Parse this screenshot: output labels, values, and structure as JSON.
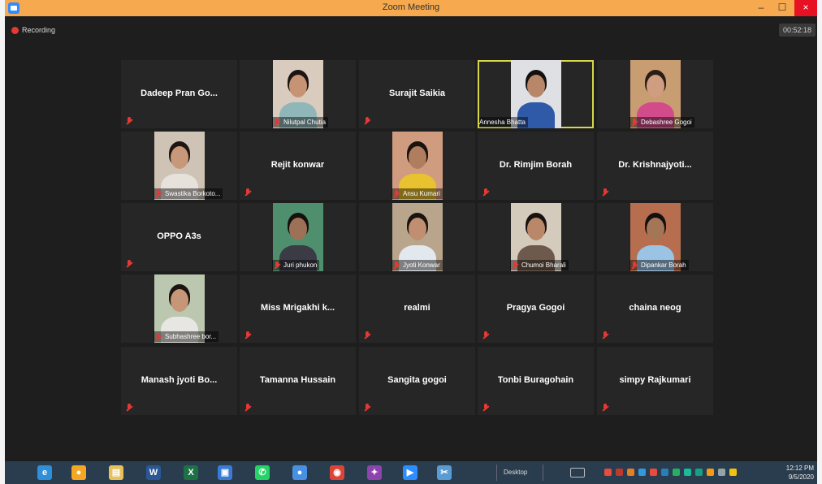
{
  "window": {
    "title": "Zoom Meeting",
    "minimize_label": "–",
    "maximize_label": "☐",
    "close_label": "×"
  },
  "meeting": {
    "recording_label": "Recording",
    "elapsed": "00:52:18"
  },
  "tiles": [
    {
      "name": "Dadeep Pran Go...",
      "video": false
    },
    {
      "name": "Nilutpal Chutia",
      "video": true,
      "skin": "#c69475",
      "bg": "#d9cbbd",
      "shirt": "#8fb6b8",
      "hair": "#1a1412"
    },
    {
      "name": "Surajit Saikia",
      "video": false
    },
    {
      "name": "Annesha Bhatta",
      "video": true,
      "active": true,
      "skin": "#b8876a",
      "bg": "#dfe0e4",
      "shirt": "#2f5aa8",
      "hair": "#141010"
    },
    {
      "name": "Debashree Gogoi",
      "video": true,
      "skin": "#cf9d80",
      "bg": "#c99d72",
      "shirt": "#d24b8a",
      "hair": "#2a1c16"
    },
    {
      "name": "Swastika Borkoto...",
      "video": true,
      "skin": "#c7987a",
      "bg": "#cfc3b6",
      "shirt": "#e6e1da",
      "hair": "#1f1612"
    },
    {
      "name": "Rejit konwar",
      "video": false
    },
    {
      "name": "Ansu Kumari",
      "video": true,
      "skin": "#b07e5f",
      "bg": "#cf9c80",
      "shirt": "#e9c230",
      "hair": "#1a120e"
    },
    {
      "name": "Dr. Rimjim Borah",
      "video": false
    },
    {
      "name": "Dr. Krishnajyoti...",
      "video": false
    },
    {
      "name": "OPPO A3s",
      "video": false
    },
    {
      "name": "Juri phukon",
      "video": true,
      "skin": "#9c7158",
      "bg": "#4f8f6e",
      "shirt": "#3b3b46",
      "hair": "#16100e"
    },
    {
      "name": "Jyoti Konwar",
      "video": true,
      "skin": "#c08e70",
      "bg": "#b8a58c",
      "shirt": "#e3e7ee",
      "hair": "#1a1410"
    },
    {
      "name": "Chumoi Bharali",
      "video": true,
      "skin": "#b88869",
      "bg": "#d4cbbd",
      "shirt": "#6d5a4c",
      "hair": "#181210"
    },
    {
      "name": "Dipankar Borah",
      "video": true,
      "skin": "#a47657",
      "bg": "#b66e4f",
      "shirt": "#9bc3e3",
      "hair": "#141010"
    },
    {
      "name": "Subhashree bor...",
      "video": true,
      "skin": "#c59677",
      "bg": "#bcc7b0",
      "shirt": "#e8e6e3",
      "hair": "#1b1410"
    },
    {
      "name": "Miss  Mrigakhi  k...",
      "video": false
    },
    {
      "name": "realmi",
      "video": false
    },
    {
      "name": "Pragya Gogoi",
      "video": false
    },
    {
      "name": "chaina neog",
      "video": false
    },
    {
      "name": "Manash jyoti Bo...",
      "video": false
    },
    {
      "name": "Tamanna Hussain",
      "video": false
    },
    {
      "name": "Sangita gogoi",
      "video": false
    },
    {
      "name": "Tonbi Buragohain",
      "video": false
    },
    {
      "name": "simpy Rajkumari",
      "video": false
    }
  ],
  "taskbar": {
    "desktop_label": "Desktop",
    "time": "12:12 PM",
    "date": "9/5/2020",
    "apps": [
      {
        "icon": "internet-explorer-icon",
        "color": "#2f8fd8"
      },
      {
        "icon": "orange-ball-app-icon",
        "color": "#f5a623"
      },
      {
        "icon": "file-explorer-icon",
        "color": "#e8c15a"
      },
      {
        "icon": "word-icon",
        "color": "#2b5797"
      },
      {
        "icon": "excel-icon",
        "color": "#1e7145"
      },
      {
        "icon": "paint-icon",
        "color": "#3a7bd5"
      },
      {
        "icon": "whatsapp-icon",
        "color": "#25d366"
      },
      {
        "icon": "media-app-icon",
        "color": "#4a90e2"
      },
      {
        "icon": "chrome-icon",
        "color": "#db4437"
      },
      {
        "icon": "game-app-icon",
        "color": "#8e44ad"
      },
      {
        "icon": "zoom-icon",
        "color": "#2d8cff"
      },
      {
        "icon": "snipping-tool-icon",
        "color": "#5a9bd4"
      }
    ],
    "tray_colors": [
      "#e74c3c",
      "#c0392b",
      "#e67e22",
      "#3498db",
      "#e74c3c",
      "#2980b9",
      "#27ae60",
      "#1abc9c",
      "#16a085",
      "#f39c12",
      "#95a5a6",
      "#f1c40f"
    ]
  }
}
